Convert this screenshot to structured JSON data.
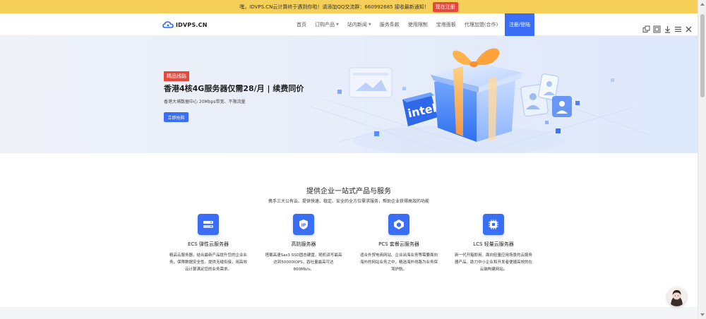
{
  "notice": {
    "text": "嘿，IDVPS.CN云计算终于遇到你啦！请添加QQ交流群：660992685 接收最新通知！",
    "button": "现在注册"
  },
  "header": {
    "logo_text": "IDVPS.CN",
    "nav": [
      {
        "label": "首页",
        "dropdown": false
      },
      {
        "label": "订购产品",
        "dropdown": true
      },
      {
        "label": "站内新闻",
        "dropdown": true
      },
      {
        "label": "服务条款",
        "dropdown": false
      },
      {
        "label": "使用限制",
        "dropdown": false
      },
      {
        "label": "宝塔面板",
        "dropdown": false
      },
      {
        "label": "代理加盟(合作)",
        "dropdown": false
      }
    ],
    "login_button": "注册/登陆"
  },
  "toolbar": {
    "icons": [
      "popout-icon",
      "fullscreen-icon",
      "download-icon",
      "menu-icon",
      "close-icon"
    ]
  },
  "hero": {
    "tag": "精品线路",
    "title": "香港4核4G服务器仅需28/月 | 续费同价",
    "subtitle": "香港大埔数据中心 20Mbps带宽、不限流量",
    "button": "立即抢购",
    "chip_text": "intel"
  },
  "services": {
    "title": "提供企业一站式产品与服务",
    "subtitle": "携手三大公有云、提供快速、稳定、安全的全方位需求服务，帮助企业获得高效的功能",
    "cards": [
      {
        "icon": "ecs-server-icon",
        "name": "ECS 弹性云服务器",
        "desc": "精品云服务器，结合最新产品提升您的企业业务，保障数据安全性。提供无缝衔接，用高效云计算满足您的业务需求。"
      },
      {
        "icon": "ip-shield-icon",
        "name": "高防服务器",
        "desc": "搭载高速Sas3 SSD固态硬盘，随机读写最高达到50000IOPS，吞吐量最高可达800Mb/s。"
      },
      {
        "icon": "pcs-cube-icon",
        "name": "PCS 套餐云服务器",
        "desc": "适合外贸电商网站、企业出海业务等需要面向海外的网站业务之中，精选海外线路为业务保驾护航。"
      },
      {
        "icon": "lcs-chip-icon",
        "name": "LCS 轻量云服务器",
        "desc": "新一代开箱即用、面向轻量应用场景的云服务器产品，助力中小企业和开发者便捷高效的在云端构建网站。"
      }
    ]
  },
  "colors": {
    "accent": "#3b6ef6",
    "notice_bg": "#f5cf58",
    "tag_red": "#e8483c"
  }
}
